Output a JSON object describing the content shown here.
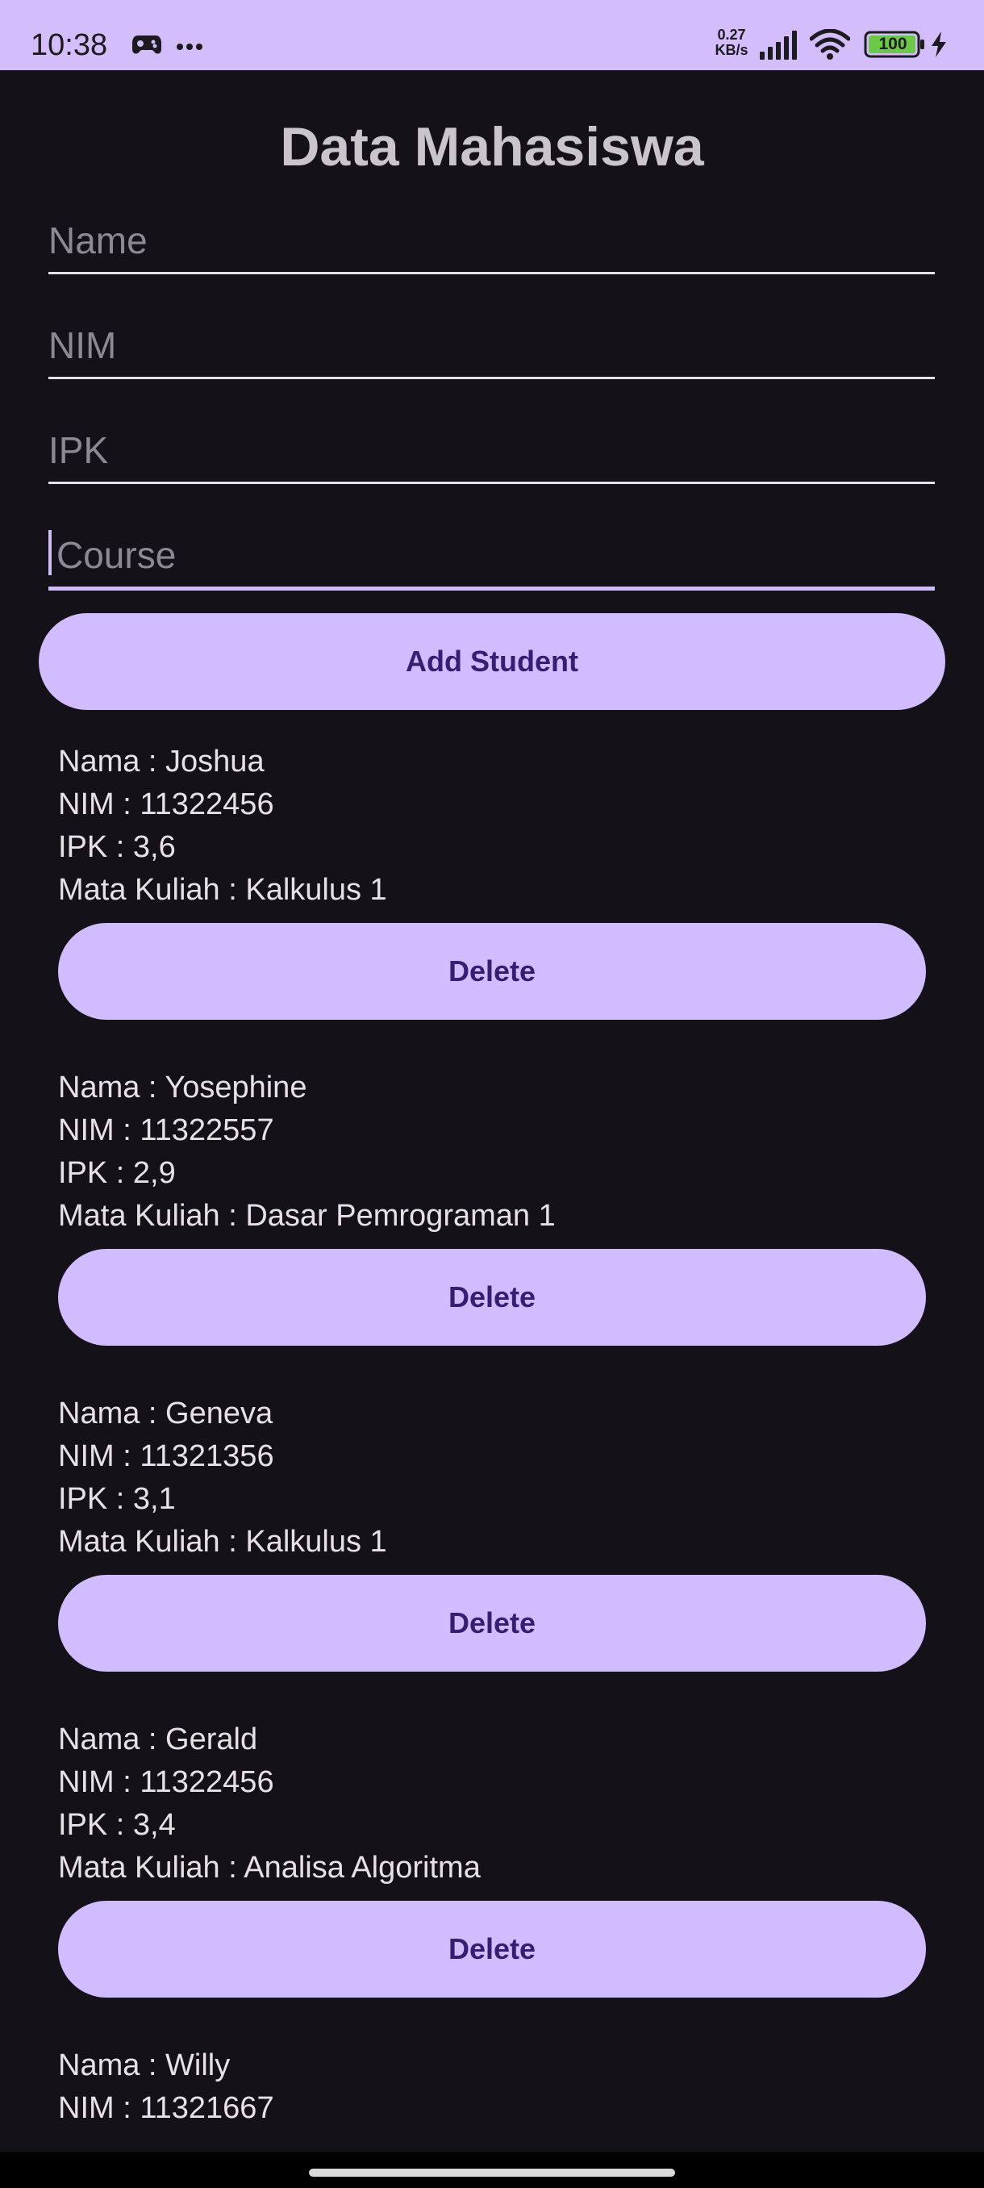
{
  "status_bar": {
    "time": "10:38",
    "net_speed_value": "0.27",
    "net_speed_unit": "KB/s",
    "battery": "100",
    "background_color": "#d3bdfb",
    "icons": [
      "game-controller-icon",
      "more-dots-icon",
      "signal-icon",
      "wifi-icon",
      "battery-icon",
      "charging-icon"
    ]
  },
  "app": {
    "title": "Data Mahasiswa",
    "background_color": "#141218",
    "accent_color": "#d0bcff",
    "button_text_color": "#381e72"
  },
  "form": {
    "name_placeholder": "Name",
    "nim_placeholder": "NIM",
    "ipk_placeholder": "IPK",
    "course_placeholder": "Course",
    "focused_field": "Course",
    "add_button_label": "Add Student"
  },
  "students": [
    {
      "name_line": "Nama : Joshua",
      "nim_line": "NIM : 11322456",
      "ipk_line": "IPK : 3,6",
      "course_line": "Mata Kuliah : Kalkulus 1",
      "delete_label": "Delete"
    },
    {
      "name_line": "Nama : Yosephine",
      "nim_line": "NIM : 11322557",
      "ipk_line": "IPK : 2,9",
      "course_line": "Mata Kuliah : Dasar Pemrograman 1",
      "delete_label": "Delete"
    },
    {
      "name_line": "Nama : Geneva",
      "nim_line": "NIM : 11321356",
      "ipk_line": "IPK : 3,1",
      "course_line": "Mata Kuliah : Kalkulus 1",
      "delete_label": "Delete"
    },
    {
      "name_line": "Nama : Gerald",
      "nim_line": "NIM : 11322456",
      "ipk_line": "IPK : 3,4",
      "course_line": "Mata Kuliah : Analisa Algoritma",
      "delete_label": "Delete"
    },
    {
      "name_line": "Nama : Willy",
      "nim_line": "NIM : 11321667"
    }
  ]
}
